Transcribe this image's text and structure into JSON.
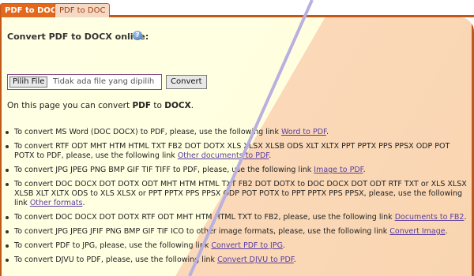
{
  "tabs": {
    "active_label": "PDF to DOCX",
    "inactive_label": "PDF to DOC"
  },
  "heading": "Convert PDF to DOCX online:",
  "help_icon": "?",
  "file_input": {
    "button_label": "Pilih File",
    "status_text": "Tidak ada file yang dipilih"
  },
  "convert_label": "Convert",
  "intro": {
    "prefix": "On this page you can convert ",
    "from": "PDF",
    "middle": " to ",
    "to": "DOCX",
    "suffix": "."
  },
  "items": [
    {
      "text": "To convert MS Word (DOC DOCX) to PDF, please, use the following link ",
      "link": "Word to PDF",
      "tail": "."
    },
    {
      "text": "To convert RTF ODT MHT HTM HTML TXT FB2 DOT DOTX XLS XLSX XLSB ODS XLT XLTX PPT PPTX PPS PPSX ODP POT POTX to PDF, please, use the following link ",
      "link": "Other documents to PDF",
      "tail": "."
    },
    {
      "text": "To convert JPG JPEG PNG BMP GIF TIF TIFF to PDF, please, use the following link ",
      "link": "Image to PDF",
      "tail": "."
    },
    {
      "text": "To convert DOC DOCX DOT DOTX ODT MHT HTM HTML TXT FB2 DOT DOTX to DOC DOCX DOT ODT RTF TXT or XLS XLSX XLSB XLT XLTX ODS to XLS XLSX or PPT PPTX PPS PPSX ODP POT POTX to PPT PPTX PPS PPSX, please, use the following link ",
      "link": "Other formats",
      "tail": "."
    },
    {
      "text": "To convert DOC DOCX DOT DOTX RTF ODT MHT HTM HTML TXT to FB2, please, use the following link ",
      "link": "Documents to FB2",
      "tail": "."
    },
    {
      "text": "To convert JPG JPEG JFIF PNG BMP GIF TIF ICO to other image formats, please, use the following link ",
      "link": "Convert Image",
      "tail": "."
    },
    {
      "text": "To convert PDF to JPG, please, use the following link ",
      "link": "Convert PDF to JPG",
      "tail": "."
    },
    {
      "text": "To convert DJVU to PDF, please, use the following link ",
      "link": "Convert DJVU to PDF",
      "tail": "."
    }
  ],
  "colors": {
    "accent": "#e2681e",
    "border": "#c1581a",
    "link": "#5a3da0",
    "left_bg": "#ffffe0",
    "right_bg": "#fbd9b8",
    "diagonal": "#b9b0e0"
  }
}
